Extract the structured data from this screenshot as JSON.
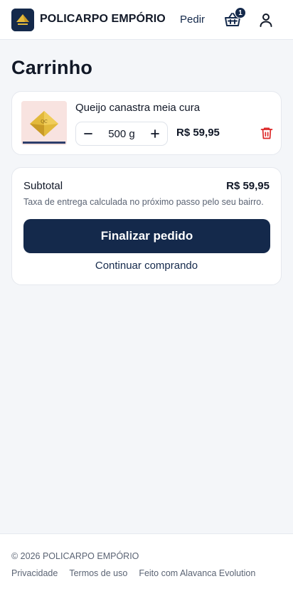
{
  "header": {
    "brand": "POLICARPO EMPÓRIO",
    "logo_icon": "cheese-logo-icon",
    "nav_order_label": "Pedir",
    "cart_icon": "basket-icon",
    "cart_count": "1",
    "user_icon": "user-icon"
  },
  "page": {
    "title": "Carrinho"
  },
  "cart": {
    "items": [
      {
        "name": "Queijo canastra meia cura",
        "image_icon": "cheese-product-image",
        "quantity": "500 g",
        "price": "R$ 59,95",
        "remove_icon": "trash-icon"
      }
    ]
  },
  "summary": {
    "subtotal_label": "Subtotal",
    "subtotal_value": "R$ 59,95",
    "delivery_note": "Taxa de entrega calculada no próximo passo pelo seu bairro.",
    "checkout_label": "Finalizar pedido",
    "continue_label": "Continuar comprando"
  },
  "footer": {
    "copyright": "© 2026 POLICARPO EMPÓRIO",
    "links": [
      "Privacidade",
      "Termos de uso",
      "Feito com Alavanca Evolution"
    ]
  },
  "colors": {
    "primary": "#14294b",
    "danger": "#dc2626",
    "background": "#f4f6f9",
    "logo_gold": "#e2b93b"
  }
}
